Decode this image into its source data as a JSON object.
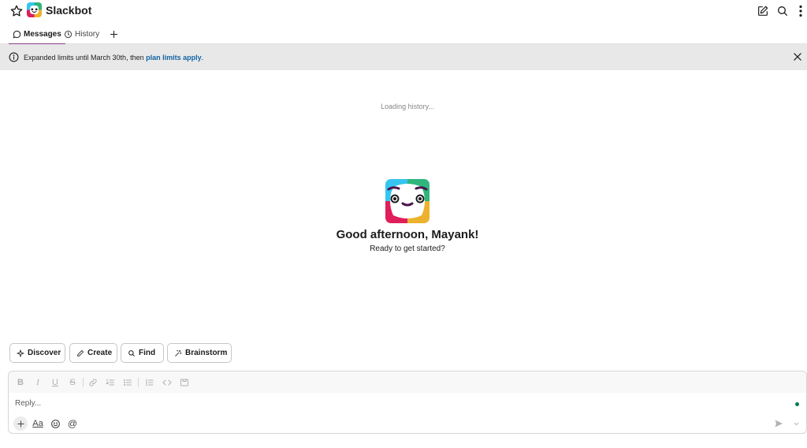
{
  "header": {
    "title": "Slackbot",
    "icons": {
      "star": "star-icon",
      "logo": "slackbot-logo",
      "compose": "compose-icon",
      "search": "search-icon",
      "more": "more-vertical-icon"
    }
  },
  "tabs": [
    {
      "label": "Messages",
      "icon": "message-icon",
      "active": true
    },
    {
      "label": "History",
      "icon": "clock-icon",
      "active": false
    }
  ],
  "banner": {
    "text": "Expanded limits until March 30th, then ",
    "link": "plan limits apply",
    "suffix": "."
  },
  "main": {
    "loading": "Loading history...",
    "greeting": "Good afternoon, Mayank!",
    "subtitle": "Ready to get started?"
  },
  "chips": [
    {
      "label": "Discover",
      "icon": "sparkle-icon"
    },
    {
      "label": "Create",
      "icon": "pencil-icon"
    },
    {
      "label": "Find",
      "icon": "search-icon"
    },
    {
      "label": "Brainstorm",
      "icon": "magic-wand-icon"
    }
  ],
  "composer": {
    "placeholder": "Reply...",
    "format_label": "Aa",
    "mention_label": "@"
  },
  "colors": {
    "active_tab": "#8a3f86",
    "link": "#1264a3",
    "banner_bg": "#e8e8e8",
    "online": "#007a5a"
  }
}
